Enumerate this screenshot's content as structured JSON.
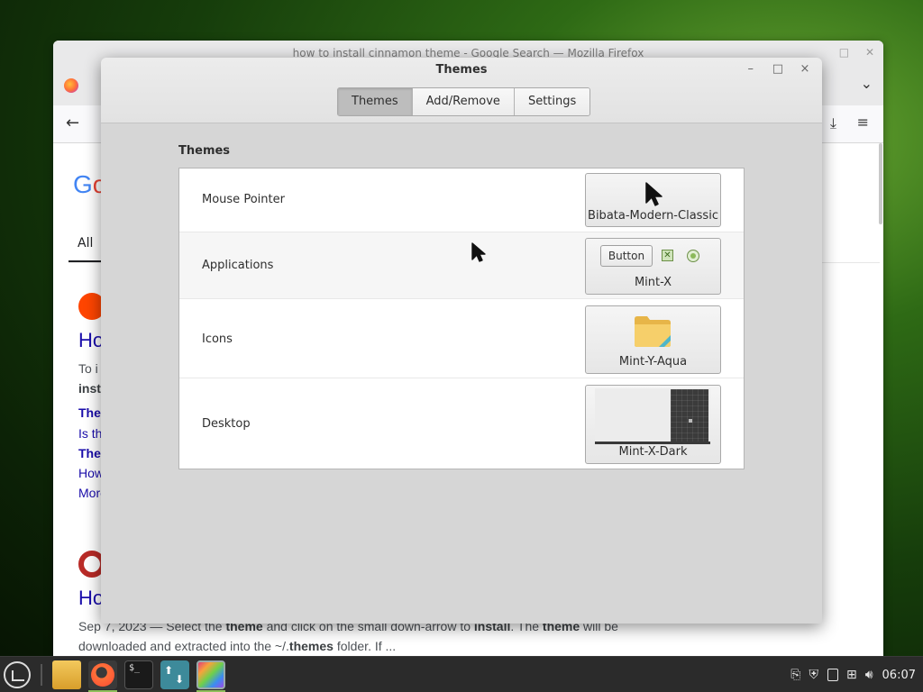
{
  "browser": {
    "title": "how to install cinnamon theme - Google Search — Mozilla Firefox",
    "google_text_1": "G",
    "google_text_2": "o",
    "tab_all": "All",
    "result1": {
      "title": "Ho",
      "line1": "To i",
      "line2": "inst",
      "link1": "The",
      "line3": "Is th",
      "link2": "The",
      "line4": "How",
      "line5": "More"
    },
    "result2": {
      "title": "Ho",
      "snippet_date": "Sep 7, 2023 — Select the ",
      "snippet_b1": "theme",
      "snippet_mid1": " and click on the small down-arrow to ",
      "snippet_b2": "install",
      "snippet_mid2": ". The ",
      "snippet_b3": "theme",
      "snippet_end": " will be",
      "snippet2_start": "downloaded and extracted into the ~/.",
      "snippet2_b": "themes",
      "snippet2_end": " folder. If ..."
    }
  },
  "dialog": {
    "title": "Themes",
    "tabs": [
      {
        "label": "Themes",
        "active": true
      },
      {
        "label": "Add/Remove",
        "active": false
      },
      {
        "label": "Settings",
        "active": false
      }
    ],
    "section_title": "Themes",
    "rows": [
      {
        "label": "Mouse Pointer",
        "value": "Bibata-Modern-Classic",
        "icon": "pointer-cursor-icon"
      },
      {
        "label": "Applications",
        "value": "Mint-X",
        "preview_button": "Button",
        "icon": "app-widgets-preview"
      },
      {
        "label": "Icons",
        "value": "Mint-Y-Aqua",
        "icon": "folder-icon"
      },
      {
        "label": "Desktop",
        "value": "Mint-X-Dark",
        "icon": "desktop-preview"
      }
    ],
    "controls": {
      "minimize": "–",
      "maximize": "□",
      "close": "×"
    }
  },
  "taskbar": {
    "apps": [
      "files",
      "firefox",
      "terminal",
      "update-manager",
      "themes"
    ],
    "terminal_glyph": "$_",
    "clock": "06:07",
    "tray_icons": [
      "clipboard-icon",
      "shield-icon",
      "drive-icon",
      "network-icon",
      "volume-icon"
    ]
  },
  "colors": {
    "accent": "#8fbf5d",
    "dialog_bg": "#d6d6d6",
    "taskbar_bg": "#2b2b2b"
  }
}
